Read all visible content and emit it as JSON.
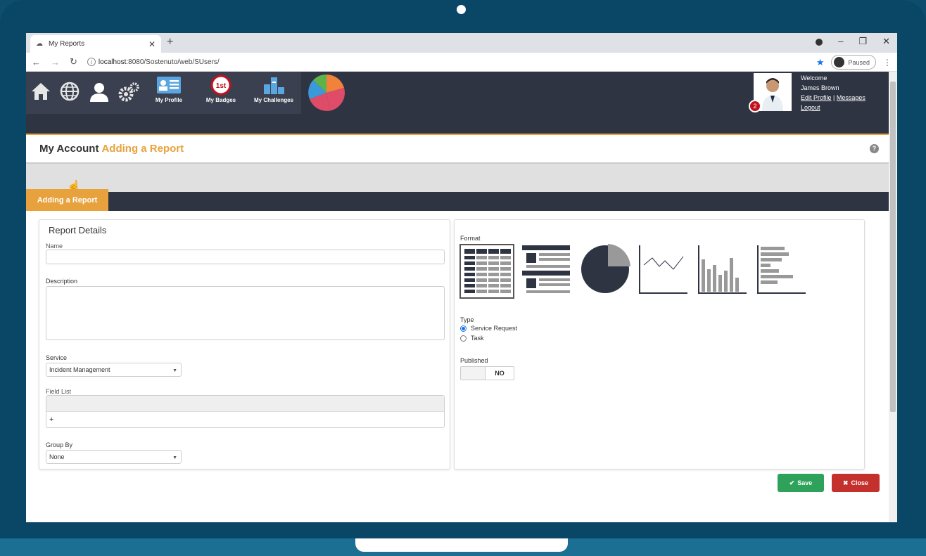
{
  "browser": {
    "tab_title": "My Reports",
    "url_host": "localhost",
    "url_path": ":8080/Sostenuto/web/SUsers/",
    "profile_status": "Paused"
  },
  "nav": {
    "items": [
      {
        "label": "My Profile"
      },
      {
        "label": "My Badges"
      },
      {
        "label": "My Challenges"
      }
    ],
    "badge_glyph": "1st"
  },
  "user": {
    "welcome": "Welcome",
    "name": "James Brown",
    "edit_profile": "Edit Profile",
    "separator": "|",
    "messages": "Messages",
    "logout": "Logout",
    "notification_count": "2"
  },
  "page": {
    "title_main": "My Account",
    "title_sub": "Adding a Report",
    "section_tab": "Adding a Report"
  },
  "form": {
    "heading": "Report Details",
    "name_label": "Name",
    "name_value": "",
    "description_label": "Description",
    "description_value": "",
    "service_label": "Service",
    "service_value": "Incident Management",
    "field_list_label": "Field List",
    "field_list_add": "+",
    "group_by_label": "Group By",
    "group_by_value": "None"
  },
  "options": {
    "format_label": "Format",
    "format_selected": "table",
    "type_label": "Type",
    "type_options": [
      "Service Request",
      "Task"
    ],
    "type_selected": "Service Request",
    "published_label": "Published",
    "published_value": "NO"
  },
  "actions": {
    "save": "Save",
    "close": "Close"
  },
  "colors": {
    "accent": "#e8a23d",
    "navbar": "#2f3443",
    "save": "#2ea15a",
    "close": "#c4302b"
  }
}
